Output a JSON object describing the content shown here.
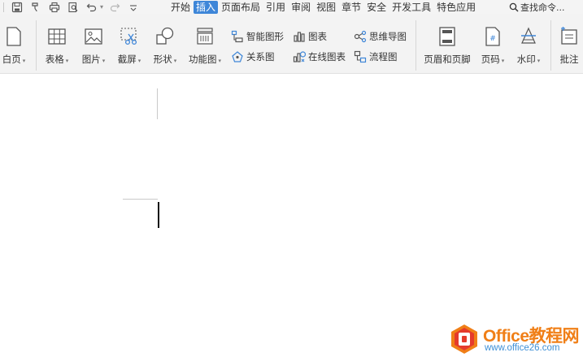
{
  "tabs": [
    "开始",
    "插入",
    "页面布局",
    "引用",
    "审阅",
    "视图",
    "章节",
    "安全",
    "开发工具",
    "特色应用"
  ],
  "active_tab": "插入",
  "quick_access": {
    "icons": [
      "save-icon",
      "format-painter-icon",
      "print-icon",
      "print-preview-icon",
      "undo-icon",
      "redo-icon",
      "customize-caret-icon"
    ]
  },
  "search": {
    "label": "查找命令..."
  },
  "ribbon": {
    "blank_page": "白页",
    "table": "表格",
    "picture": "图片",
    "screenshot": "截屏",
    "shape": "形状",
    "function_chart": "功能图",
    "smart_shape": "智能图形",
    "chart": "图表",
    "mind_map": "思维导图",
    "relation_chart": "关系图",
    "online_chart": "在线图表",
    "flowchart": "流程图",
    "header_footer": "页眉和页脚",
    "page_number": "页码",
    "watermark": "水印",
    "comment": "批注"
  },
  "branding": {
    "title": "Office教程网",
    "url": "www.office26.com",
    "colors": {
      "orange": "#f07f17",
      "red": "#e53b2c",
      "blue": "#3d8fd6"
    }
  },
  "accent_color": "#3e86d8"
}
